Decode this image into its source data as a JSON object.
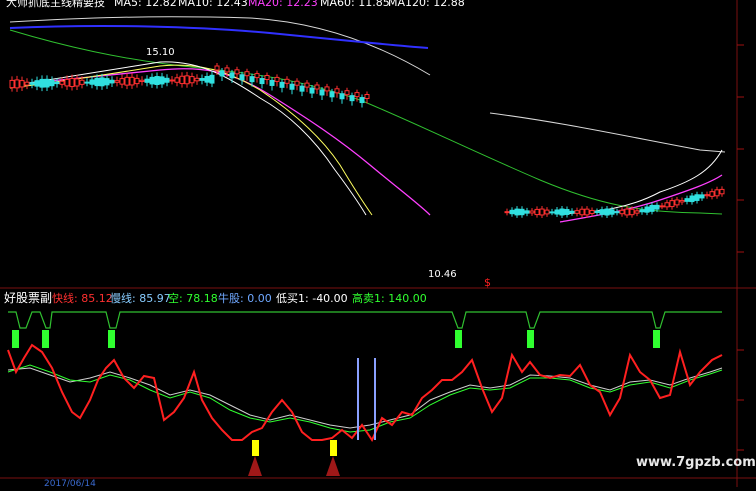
{
  "top_panel": {
    "title": "大师抓底主线精要技",
    "ma_labels": [
      {
        "text": "MA5: 12.82",
        "color": "#ffffff"
      },
      {
        "text": "MA10: 12.43",
        "color": "#ffffff"
      },
      {
        "text": "MA20: 12.23",
        "color": "#ff40ff"
      },
      {
        "text": "MA60: 11.85",
        "color": "#ffffff"
      },
      {
        "text": "MA120: 12.88",
        "color": "#ffffff"
      }
    ],
    "peak_label": "15.10",
    "low_label": "10.46",
    "marker_glyph": "$"
  },
  "sub_panel": {
    "name": "好股票副",
    "values": [
      {
        "label": "快线:",
        "value": "85.12",
        "color": "#ff3030"
      },
      {
        "label": "慢线:",
        "value": "85.97",
        "color": "#88ccff"
      },
      {
        "label": "空:",
        "value": "78.18",
        "color": "#30ff30"
      },
      {
        "label": "牛股:",
        "value": "0.00",
        "color": "#6fa8ff"
      },
      {
        "label": "低买1:",
        "value": "-40.00",
        "color": "#ffffff"
      },
      {
        "label": "高卖1:",
        "value": "140.00",
        "color": "#30ff30"
      }
    ]
  },
  "footer": {
    "date": "2017/06/14",
    "watermark": "www.7gpzb.com"
  }
}
